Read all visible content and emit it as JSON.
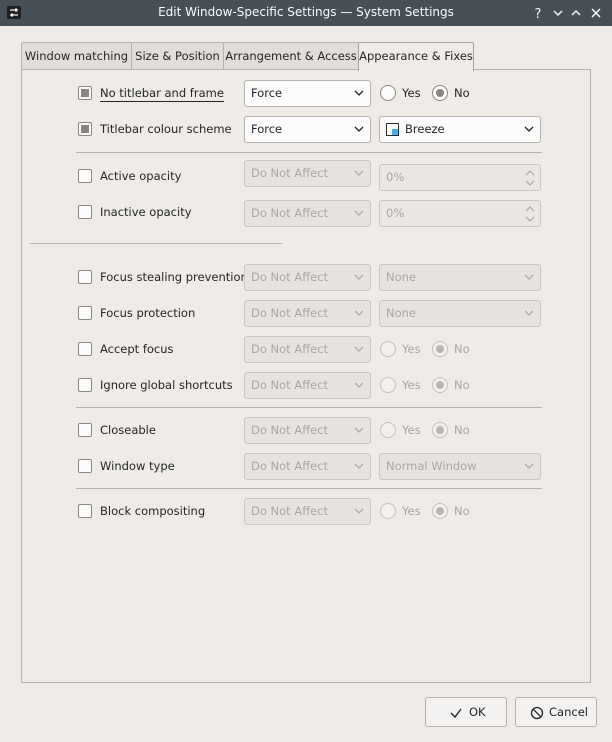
{
  "window": {
    "title": "Edit Window-Specific Settings — System Settings"
  },
  "tabs": [
    {
      "label": "Window matching"
    },
    {
      "label": "Size & Position"
    },
    {
      "label": "Arrangement & Access"
    },
    {
      "label": "Appearance & Fixes"
    }
  ],
  "rows": {
    "no_titlebar": {
      "label": "No titlebar and frame",
      "policy": "Force",
      "yes": "Yes",
      "no": "No"
    },
    "titlebar_scheme": {
      "label": "Titlebar colour scheme",
      "policy": "Force",
      "value": "Breeze"
    },
    "active_opacity": {
      "label": "Active opacity",
      "policy": "Do Not Affect",
      "value": "0%"
    },
    "inactive_opacity": {
      "label": "Inactive opacity",
      "policy": "Do Not Affect",
      "value": "0%"
    },
    "focus_stealing": {
      "label": "Focus stealing prevention",
      "policy": "Do Not Affect",
      "value": "None"
    },
    "focus_protection": {
      "label": "Focus protection",
      "policy": "Do Not Affect",
      "value": "None"
    },
    "accept_focus": {
      "label": "Accept focus",
      "policy": "Do Not Affect",
      "yes": "Yes",
      "no": "No"
    },
    "ignore_shortcuts": {
      "label": "Ignore global shortcuts",
      "policy": "Do Not Affect",
      "yes": "Yes",
      "no": "No"
    },
    "closeable": {
      "label": "Closeable",
      "policy": "Do Not Affect",
      "yes": "Yes",
      "no": "No"
    },
    "window_type": {
      "label": "Window type",
      "policy": "Do Not Affect",
      "value": "Normal Window"
    },
    "block_compositing": {
      "label": "Block compositing",
      "policy": "Do Not Affect",
      "yes": "Yes",
      "no": "No"
    }
  },
  "buttons": {
    "ok": "OK",
    "cancel": "Cancel"
  },
  "icons": {
    "app": "settings-sliders-icon",
    "help": "help-icon",
    "minimize": "chevron-down-icon",
    "maximize": "chevron-up-icon",
    "close": "close-icon",
    "ok": "check-icon",
    "cancel": "cancel-icon"
  }
}
